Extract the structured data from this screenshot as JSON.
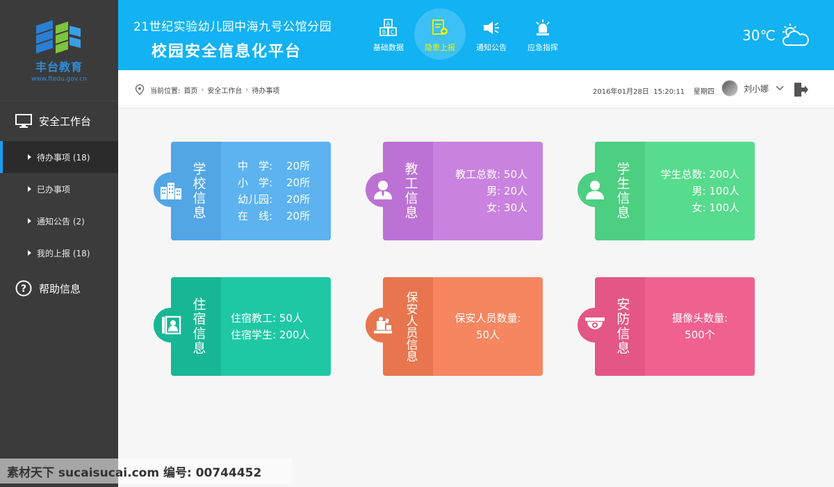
{
  "logo": {
    "name": "丰台教育",
    "url": "www.ftedu.gov.cn"
  },
  "sidebar": {
    "section_workbench": "安全工作台",
    "items": [
      {
        "label": "待办事项 (18)",
        "active": true
      },
      {
        "label": "已办事项",
        "active": false
      },
      {
        "label": "通知公告 (2)",
        "active": false
      },
      {
        "label": "我的上报 (18)",
        "active": false
      }
    ],
    "section_help": "帮助信息"
  },
  "header": {
    "school": "21世纪实验幼儿园中海九号公馆分园",
    "platform": "校园安全信息化平台",
    "nav": [
      {
        "label": "基础数据",
        "icon": "abc-blocks-icon"
      },
      {
        "label": "隐患上报",
        "icon": "report-icon",
        "active": true
      },
      {
        "label": "通知公告",
        "icon": "megaphone-icon"
      },
      {
        "label": "应急指挥",
        "icon": "siren-icon"
      }
    ],
    "weather": {
      "temp": "30℃",
      "icon": "sun-cloud-icon"
    }
  },
  "breadcrumb": {
    "prefix": "当前位置:",
    "path": [
      "首页",
      "安全工作台",
      "待办事项"
    ],
    "datetime": "2016年01月28日  15:20:11    星期四",
    "user": "刘小娜"
  },
  "cards": {
    "school": {
      "title": "学校信息",
      "rows": [
        [
          "中　学:",
          "20所"
        ],
        [
          "小　学:",
          "20所"
        ],
        [
          "幼儿园:",
          "20所"
        ],
        [
          "在　线:",
          "20所"
        ]
      ]
    },
    "staff": {
      "title": "教工信息",
      "rows": [
        "教工总数: 50人",
        "男: 20人",
        "女: 30人"
      ]
    },
    "student": {
      "title": "学生信息",
      "rows": [
        "学生总数: 200人",
        "男: 100人",
        "女: 100人"
      ]
    },
    "dorm": {
      "title": "住宿信息",
      "rows": [
        "住宿教工: 50人",
        "住宿学生: 200人"
      ]
    },
    "guard": {
      "title": "保安人员信息",
      "rows": [
        "保安人员数量:",
        "50人"
      ]
    },
    "security": {
      "title": "安防信息",
      "rows": [
        "摄像头数量:",
        "500个"
      ]
    }
  },
  "colors": {
    "school_side": "#52a6e5",
    "school_body": "#5cb3f0",
    "staff_side": "#bb72d4",
    "staff_body": "#c982df",
    "student_side": "#4ccf80",
    "student_body": "#57db8c",
    "dorm_side": "#17b796",
    "dorm_body": "#1ec8a5",
    "guard_side": "#e8754e",
    "guard_body": "#f58660",
    "security_side": "#e45685",
    "security_body": "#f0618f"
  },
  "watermark": "素材天下 sucaisucai.com   编号: 00744452"
}
